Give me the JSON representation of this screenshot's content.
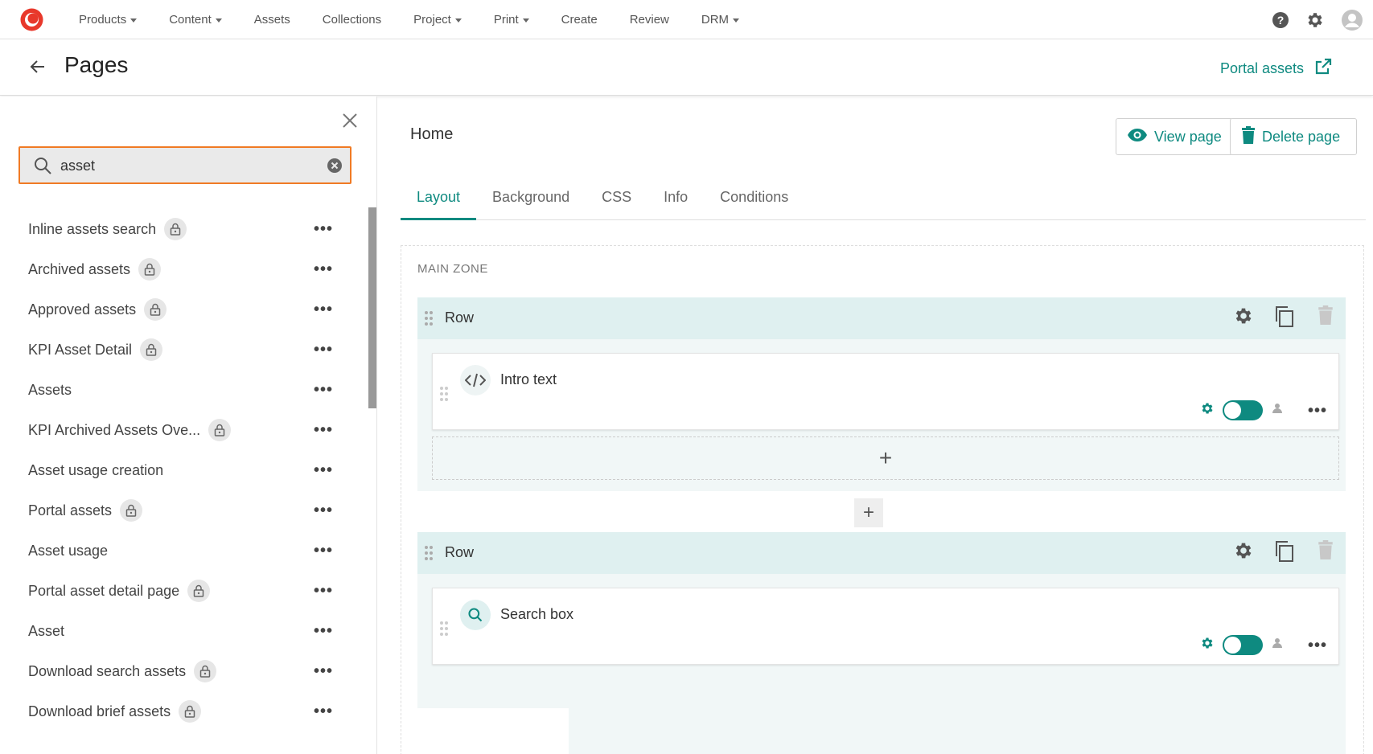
{
  "topnav": {
    "items": [
      {
        "label": "Products",
        "dropdown": true
      },
      {
        "label": "Content",
        "dropdown": true
      },
      {
        "label": "Assets",
        "dropdown": false
      },
      {
        "label": "Collections",
        "dropdown": false
      },
      {
        "label": "Project",
        "dropdown": true
      },
      {
        "label": "Print",
        "dropdown": true
      },
      {
        "label": "Create",
        "dropdown": false
      },
      {
        "label": "Review",
        "dropdown": false
      },
      {
        "label": "DRM",
        "dropdown": true
      }
    ],
    "icons": [
      "help-icon",
      "settings-icon",
      "user-avatar-icon"
    ]
  },
  "header": {
    "title": "Pages",
    "portal_link": "Portal assets"
  },
  "sidebar": {
    "search": {
      "value": "asset",
      "placeholder": ""
    },
    "items": [
      {
        "label": "Inline assets search",
        "locked": true
      },
      {
        "label": "Archived assets",
        "locked": true
      },
      {
        "label": "Approved assets",
        "locked": true
      },
      {
        "label": "KPI Asset Detail",
        "locked": true
      },
      {
        "label": "Assets",
        "locked": false
      },
      {
        "label": "KPI Archived Assets Ove...",
        "locked": true
      },
      {
        "label": "Asset usage creation",
        "locked": false
      },
      {
        "label": "Portal assets",
        "locked": true
      },
      {
        "label": "Asset usage",
        "locked": false
      },
      {
        "label": "Portal asset detail page",
        "locked": true
      },
      {
        "label": "Asset",
        "locked": false
      },
      {
        "label": "Download search assets",
        "locked": true
      },
      {
        "label": "Download brief assets",
        "locked": true
      }
    ]
  },
  "main": {
    "page_name": "Home",
    "view_button": "View page",
    "delete_button": "Delete page",
    "tabs": [
      {
        "label": "Layout",
        "active": true
      },
      {
        "label": "Background",
        "active": false
      },
      {
        "label": "CSS",
        "active": false
      },
      {
        "label": "Info",
        "active": false
      },
      {
        "label": "Conditions",
        "active": false
      }
    ],
    "zone_label": "MAIN ZONE",
    "rows": [
      {
        "title": "Row",
        "widget": {
          "label": "Intro text",
          "icon": "code-icon",
          "enabled": true
        }
      },
      {
        "title": "Row",
        "widget": {
          "label": "Search box",
          "icon": "search-icon",
          "enabled": true
        }
      }
    ],
    "add_symbol": "+"
  },
  "colors": {
    "accent": "#0e8a80",
    "search_border": "#f07a24",
    "row_header": "#dff0f0",
    "logo": "#e8382b"
  }
}
